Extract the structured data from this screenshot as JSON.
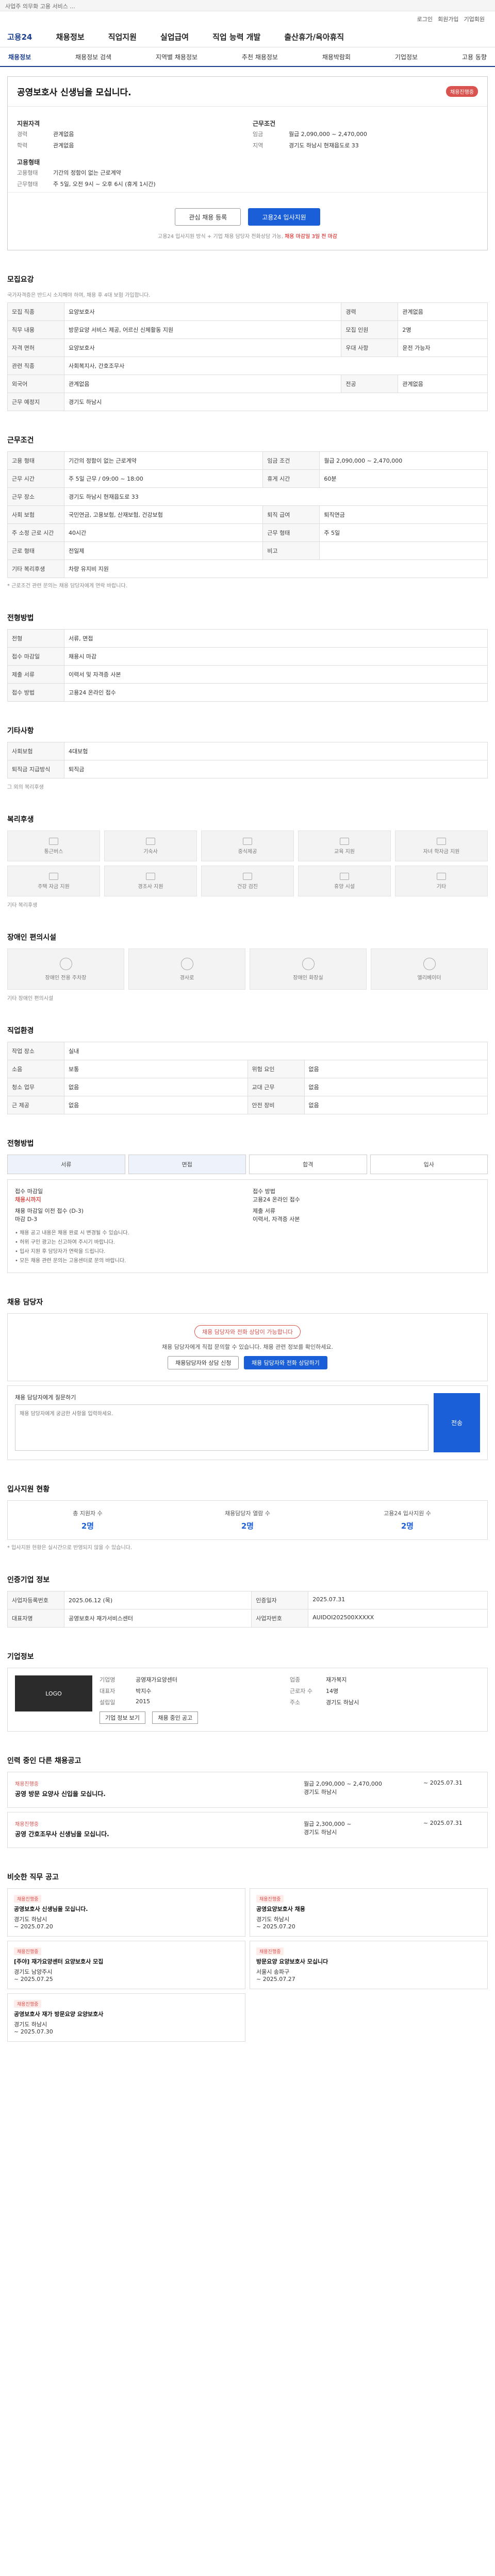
{
  "top_notice": "사업주 의무화 고용 서비스 ...",
  "utility": [
    "로그인",
    "회원가입",
    "기업회원"
  ],
  "gnb": {
    "brand": "고용24",
    "items": [
      "채용정보",
      "직업지원",
      "실업급여",
      "직업 능력 개발",
      "출산휴가/육아휴직"
    ]
  },
  "subnav": [
    "채용정보",
    "채용정보 검색",
    "지역별 채용정보",
    "추천 채용정보",
    "채용박람회",
    "기업정보",
    "고용 동향"
  ],
  "posting": {
    "title": "공영보호사 신생님을 모십니다.",
    "status_badge": "채용진행중",
    "left_label": "지원자격",
    "left_rows": [
      [
        "경력",
        "관계없음"
      ],
      [
        "학력",
        "관계없음"
      ]
    ],
    "right_label": "근무조건",
    "right_rows": [
      [
        "임금",
        "월급 2,090,000 ~ 2,470,000"
      ],
      [
        "지역",
        "경기도 하남시 현재읍도로 33"
      ]
    ],
    "cond_label": "고용형태",
    "cond_rows": [
      [
        "고용형태",
        "기간의 정함이 없는 근로계약"
      ],
      [
        "근무형태",
        "주 5일, 오전 9시 ~ 오후 6시 (휴게 1시간)"
      ]
    ],
    "apply_outline": "관심 채용 등록",
    "apply_primary": "고용24 입사지원",
    "apply_note": "고용24 입사지원 방식 + 기업 채용 담당자 전화상담 가능",
    "apply_note_em": "채용 마감일 3일 전 마감"
  },
  "recruit": {
    "title": "모집요강",
    "note": "국가자격증은 반드시 소지해야 하며, 채용 후 4대 보험 가입합니다.",
    "rows": [
      [
        "모집 직종",
        "요양보호사",
        "경력",
        "관계없음"
      ],
      [
        "직무 내용",
        "방문요양 서비스 제공, 어르신 신체활동 지원",
        "모집 인원",
        "2명"
      ],
      [
        "자격 면허",
        "요양보호사",
        "우대 사항",
        "운전 가능자"
      ],
      [
        "관련 직종",
        "사회복지사, 간호조무사",
        "",
        ""
      ],
      [
        "외국어",
        "관계없음",
        "전공",
        "관계없음"
      ],
      [
        "근무 예정지",
        "경기도 하남시",
        "",
        ""
      ]
    ]
  },
  "work": {
    "title": "근무조건",
    "rows": [
      [
        "고용 형태",
        "기간의 정함이 없는 근로계약",
        "임금 조건",
        "월급 2,090,000 ~ 2,470,000"
      ],
      [
        "근무 시간",
        "주 5일 근무 / 09:00 ~ 18:00",
        "휴게 시간",
        "60분"
      ],
      [
        "근무 장소",
        "경기도 하남시 현재읍도로 33",
        "",
        ""
      ],
      [
        "사회 보험",
        "국민연금, 고용보험, 산재보험, 건강보험",
        "퇴직 급여",
        "퇴직연금"
      ],
      [
        "주 소정 근로 시간",
        "40시간",
        "근무 형태",
        "주 5일"
      ],
      [
        "근로 형태",
        "전일제",
        "비고",
        ""
      ],
      [
        "기타 복리후생",
        "차량 유지비 지원",
        "",
        ""
      ]
    ],
    "footnote": "* 근로조건 관련 문의는 채용 담당자에게 연락 바랍니다."
  },
  "screening": {
    "title": "전형방법",
    "rows": [
      [
        "전형",
        "서류, 면접"
      ],
      [
        "접수 마감일",
        "채용시 마감"
      ],
      [
        "제출 서류",
        "이력서 및 자격증 사본"
      ],
      [
        "접수 방법",
        "고용24 온라인 접수"
      ]
    ]
  },
  "contact": {
    "title": "기타사항",
    "rows": [
      [
        "사회보험",
        "4대보험"
      ],
      [
        "퇴직금 지급방식",
        "퇴직금"
      ]
    ],
    "extra": "그 외의 복리후생"
  },
  "benefits": {
    "title": "복리후생",
    "items": [
      "통근버스",
      "기숙사",
      "중식제공",
      "교육 지원",
      "자녀 학자금 지원",
      "주택 자금 지원",
      "경조사 지원",
      "건강 검진",
      "휴양 시설",
      "기타"
    ],
    "note": "기타 복리후생"
  },
  "barrier": {
    "title": "장애인 편의시설",
    "items": [
      "장애인 전용 주차장",
      "경사로",
      "장애인 화장실",
      "엘리베이터"
    ],
    "note": "기타 장애인 편의시설"
  },
  "workplace": {
    "title": "직업환경",
    "rows": [
      [
        "작업 장소",
        "실내",
        "",
        ""
      ],
      [
        "소음",
        "보통",
        "위험 요인",
        "없음"
      ],
      [
        "청소 업무",
        "없음",
        "교대 근무",
        "없음"
      ],
      [
        "근 제공",
        "없음",
        "안전 장비",
        "없음"
      ]
    ]
  },
  "process": {
    "title": "전형방법",
    "steps": [
      "서류",
      "면접",
      "합격",
      "입사"
    ],
    "left": [
      [
        "접수 마감일",
        "채용시 마감"
      ],
      [
        "채용 마감일 이전 접수 (D-3)",
        "마감 D-3"
      ]
    ],
    "right": [
      [
        "접수 방법",
        "고용24 온라인 접수"
      ],
      [
        "제출 서류",
        "이력서, 자격증 사본"
      ]
    ],
    "red_text": "채용시까지",
    "bullets": [
      "채용 공고 내용은 채용 완료 시 변경될 수 있습니다.",
      "허위 구인 광고는 신고하여 주시기 바랍니다.",
      "입사 지원 후 담당자가 연락을 드립니다.",
      "모든 채용 관련 문의는 고용센터로 문의 바랍니다."
    ]
  },
  "consult": {
    "title": "채용 담당자",
    "pill": "채용 담당자와 전화 상담이 가능합니다",
    "desc": "채용 담당자에게 직접 문의할 수 있습니다. 채용 관련 정보를 확인하세요.",
    "btn1": "채용담당자와 상담 신청",
    "btn2": "채용 담당자와 전화 상담하기",
    "inq_label": "채용 담당자에게 질문하기",
    "inq_placeholder": "채용 담당자에게 궁금한 사항을 입력하세요.",
    "send": "전송"
  },
  "stats": {
    "title": "입사지원 현황",
    "items": [
      [
        "총 지원자 수",
        "2명"
      ],
      [
        "채용담당자 열람 수",
        "2명"
      ],
      [
        "고용24 입사지원 수",
        "2명"
      ]
    ],
    "note": "* 입사지원 현황은 실시간으로 반영되지 않을 수 있습니다."
  },
  "company_info": {
    "title": "인증기업 정보",
    "rows": [
      [
        "사업자등록번호",
        "2025.06.12 (목)",
        "인증일자",
        "2025.07.31"
      ],
      [
        "대표자명",
        "공영보호사 재가서비스센터",
        "사업자번호",
        "AUIDOI202500XXXXX"
      ]
    ]
  },
  "company": {
    "title": "기업정보",
    "logo": "LOGO",
    "rows": [
      [
        "기업명",
        "공영재가요양센터",
        "업종",
        "재가복지"
      ],
      [
        "대표자",
        "박지수",
        "근로자 수",
        "14명"
      ],
      [
        "설립일",
        "2015",
        "주소",
        "경기도 하남시"
      ]
    ],
    "buttons": [
      "기업 정보 보기",
      "채용 중인 공고"
    ]
  },
  "other_jobs": {
    "title": "인력 중인 다른 채용공고",
    "cards": [
      {
        "tag": "채용진행중",
        "title": "공영 방문 요양사 신입을 모십니다.",
        "meta": "월급 2,090,000 ~ 2,470,000",
        "loc": "경기도 하남시",
        "date": "~ 2025.07.31"
      },
      {
        "tag": "채용진행중",
        "title": "공영 간호조무사 신생님을 모십니다.",
        "meta": "월급 2,300,000 ~",
        "loc": "경기도 하남시",
        "date": "~ 2025.07.31"
      }
    ]
  },
  "similar": {
    "title": "비슷한 직무 공고",
    "cards": [
      {
        "chip": "채용진행중",
        "title": "공영보호사 신생님을 모십니다.",
        "loc": "경기도 하남시",
        "date": "~ 2025.07.20"
      },
      {
        "chip": "채용진행중",
        "title": "공영요양보호사 채용",
        "loc": "경기도 하남시",
        "date": "~ 2025.07.20"
      },
      {
        "chip": "채용진행중",
        "title": "[주야] 재가요양센터 요양보호사 모집",
        "loc": "경기도 남양주시",
        "date": "~ 2025.07.25"
      },
      {
        "chip": "채용진행중",
        "title": "방문요양 요양보호사 모십니다",
        "loc": "서울시 송파구",
        "date": "~ 2025.07.27"
      },
      {
        "chip": "채용진행중",
        "title": "공영보호사 재가 방문요양 요양보호사",
        "loc": "경기도 하남시",
        "date": "~ 2025.07.30"
      }
    ]
  }
}
